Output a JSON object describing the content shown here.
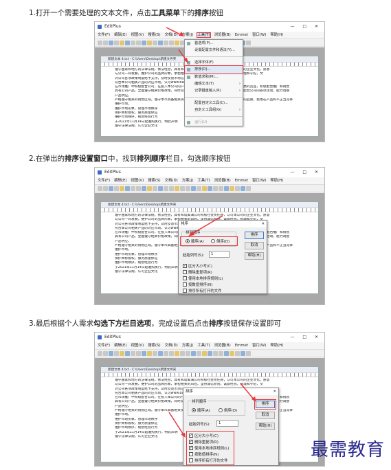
{
  "steps": [
    {
      "pre": "1.打开一个需要处理的文本文件，点击",
      "bold1": "工具菜单",
      "mid": "下的",
      "bold2": "排序",
      "post": "按钮"
    },
    {
      "pre": "2.在弹出的",
      "bold1": "排序设置窗口",
      "mid": "中，找到",
      "bold2": "排列顺序",
      "post": "栏目，勾选顺序按钮"
    },
    {
      "pre": "3.最后根据个人需求",
      "bold1": "勾选下方栏目选项",
      "mid": "，完成设置后点击",
      "bold2": "排序",
      "post": "按钮保存设置即可"
    }
  ],
  "app": {
    "title": "EditPlus",
    "window_controls": "— □ ✕",
    "menus": [
      "文件(F)",
      "编辑(E)",
      "视图(V)",
      "搜索(S)",
      "文档(D)",
      "方案(J)",
      "工具(T)",
      "浏览器(B)",
      "Emmet",
      "窗口(W)",
      "帮助(H)"
    ],
    "doc_title": "新建文本 4.txt - C:\\Users\\Desktop\\新建文件夹"
  },
  "doc_lines": [
    {
      "n": "1",
      "t": "遵守国家和地方的法律法规，依法经营，具有和谐美满公司积极社会责任感，认可本公司的企业文化，愿意"
    },
    {
      "n": "",
      "t": "与公司一同发展，维护公司的品牌形象，承担相关的风险。坚持诚信原则，诚意经营。管理和守纪，文"
    },
    {
      "n": "2",
      "t": "对公司各项政策制度给予支持，及时反馈市场信息。"
    },
    {
      "n": "3",
      "t": "符合本公司相关产品的对应市场。认可www.baidu.com。"
    },
    {
      "n": "",
      "t": "在市场推广中积极配合公司，在投入本公司的产品推广活动之前，不经营与本公司产品同类的竞品，积极配合推广和销售"
    },
    {
      "n": "",
      "t": "具有公司产品，全面遵守相关价格政策，同时及时并且有效地向公司提交月度销售计划，配合公司的各项活动，能力调整"
    },
    {
      "n": "",
      "t": "产品供应。"
    },
    {
      "n": "4",
      "t": "严格遵守相关的销售区域。遵守本市具备相关资质，了解与遵守的品质要求，维护本公司的品质，拒绝在产品和不正当竞争"
    },
    {
      "n": "",
      "t": "维护市场。"
    },
    {
      "n": "5",
      "t": "维护市场形象，管理市场秩序"
    },
    {
      "n": "6",
      "t": "保护商标版权，服务质量保证"
    },
    {
      "n": "7",
      "t": "维护市场秩序，规划经营行为"
    },
    {
      "n": "8",
      "t": "于2021年11月14日起遵照执行，特此声明"
    },
    {
      "n": "9",
      "t": "遵守法律法规，认可企业文化"
    }
  ],
  "tools_menu": [
    {
      "label": "首选项(P)...",
      "selected": false
    },
    {
      "label": "设置配置文件和语法(Y)...",
      "selected": false
    },
    {
      "label": "",
      "separator": true
    },
    {
      "label": "选择字体(F)",
      "selected": false
    },
    {
      "label": "排序(O)...",
      "selected": true
    },
    {
      "label": "数值求和(M)...",
      "selected": false
    },
    {
      "label": "编辑文本(T)",
      "selected": false
    },
    {
      "label": "记录键盘输入(R)",
      "selected": false
    },
    {
      "label": "",
      "separator": true
    },
    {
      "label": "配置自定义工具(C)...",
      "selected": false
    },
    {
      "label": "自定义工具组(G)",
      "selected": false
    },
    {
      "label": "",
      "separator": true
    },
    {
      "label": "运行(U)",
      "selected": false
    }
  ],
  "sort_dialog": {
    "title": "排序",
    "close": "✕",
    "group_label": "排列顺序",
    "ascending": "顺序(A)",
    "descending": "倒序(D)",
    "key_label": "起始列号(S):",
    "key_value": "1",
    "options": [
      {
        "label": "区分大小写(C)",
        "checked": true
      },
      {
        "label": "删除重复项(R)",
        "checked": false
      },
      {
        "label": "使用本地排序规则(L)",
        "checked": false
      },
      {
        "label": "按数值排序(N)",
        "checked": false
      },
      {
        "label": "排序所有打开的文件",
        "checked": false
      }
    ],
    "options_step3": [
      {
        "label": "区分大小写(C)",
        "checked": true
      },
      {
        "label": "删除重复项(R)",
        "checked": true
      },
      {
        "label": "使用本地排序规则(L)",
        "checked": true
      },
      {
        "label": "按数值排序(N)",
        "checked": false
      },
      {
        "label": "排序所有打开的文件",
        "checked": false
      }
    ],
    "sort_button": "排序",
    "cancel_button": "取消",
    "help_button": "帮助(H)"
  },
  "watermark": "最需教育",
  "colors": {
    "highlight_red": "#e8383d",
    "watermark": "#2d2b8f"
  }
}
